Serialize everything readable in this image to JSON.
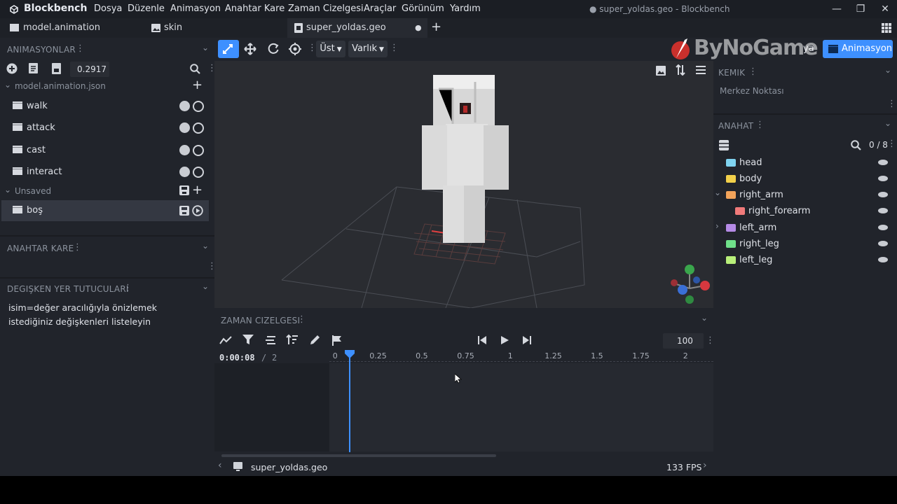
{
  "app": {
    "name": "Blockbench",
    "window_title": "● super_yoldas.geo - Blockbench",
    "menu": [
      "Dosya",
      "Düzenle",
      "Animasyon",
      "Anahtar Kare",
      "Zaman Cizelgesi",
      "Araçlar",
      "Görünüm",
      "Yardım"
    ]
  },
  "tabs": [
    {
      "label": "model.animation",
      "icon": "clapper-icon"
    },
    {
      "label": "skin",
      "icon": "image-icon"
    },
    {
      "label": "super_yoldas.geo",
      "icon": "model-icon",
      "active": true
    }
  ],
  "left": {
    "animations_title": "ANIMASYONLAR",
    "anim_value": "0.2917",
    "groups": [
      {
        "label": "model.animation.json",
        "items": [
          "walk",
          "attack",
          "cast",
          "interact"
        ]
      },
      {
        "label": "Unsaved",
        "items": [
          "boş"
        ]
      }
    ],
    "keyframe_title": "ANAHTAR KARE",
    "placeholders_title": "DEGIŞKEN YER TUTUCULARI",
    "placeholders_text": "isim=değer aracılığıyla önizlemek istediğiniz değişkenleri listeleyin"
  },
  "toolbar": {
    "view_select": "Üst",
    "space_select": "Varlık",
    "mode_edit_partial": "ya",
    "mode_animate": "Animasyon",
    "watermark": "ByNoGame"
  },
  "right": {
    "bone_title": "KEMIK",
    "pivot_label": "Merkez Noktası",
    "outliner_title": "ANAHAT",
    "outliner_count": "0 / 8",
    "items": [
      {
        "label": "head",
        "color": "#7fd3f0",
        "indent": 0,
        "arrow": ""
      },
      {
        "label": "body",
        "color": "#f2d04a",
        "indent": 0,
        "arrow": ""
      },
      {
        "label": "right_arm",
        "color": "#f2a35a",
        "indent": 0,
        "arrow": "open"
      },
      {
        "label": "right_forearm",
        "color": "#f07a7a",
        "indent": 1,
        "arrow": ""
      },
      {
        "label": "left_arm",
        "color": "#b58ae6",
        "indent": 0,
        "arrow": "closed"
      },
      {
        "label": "right_leg",
        "color": "#6fe08a",
        "indent": 0,
        "arrow": ""
      },
      {
        "label": "left_leg",
        "color": "#b8ef7a",
        "indent": 0,
        "arrow": ""
      }
    ]
  },
  "timeline": {
    "title": "ZAMAN CIZELGESI",
    "time": "0:00:08",
    "separator": "/",
    "length": "2",
    "zoom_value": "100",
    "ticks": [
      "0",
      "0.25",
      "0.5",
      "0.75",
      "1",
      "1.25",
      "1.5",
      "1.75",
      "2"
    ],
    "playhead_time": 0.083
  },
  "status": {
    "file": "super_yoldas.geo",
    "fps": "133 FPS"
  },
  "colors": {
    "accent": "#3e90ff",
    "panel": "#21242b",
    "viewport": "#2a2c31"
  }
}
